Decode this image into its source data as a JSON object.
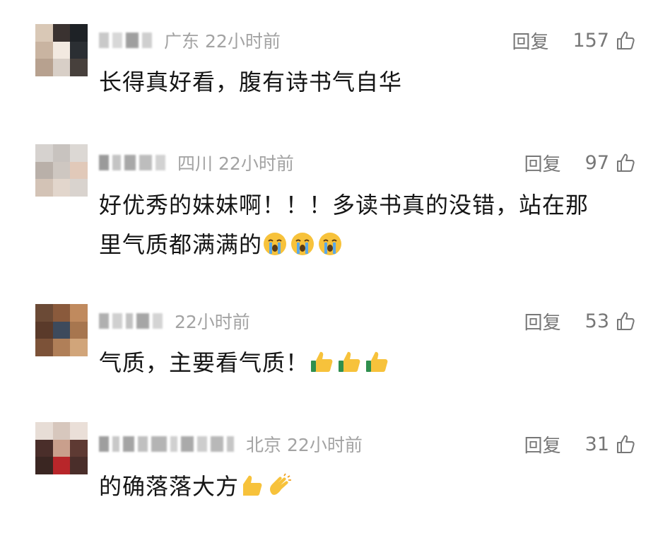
{
  "comments": [
    {
      "location": "广东",
      "time": "22小时前",
      "reply_label": "回复",
      "likes": "157",
      "text": "长得真好看，腹有诗书气自华",
      "emojis": []
    },
    {
      "location": "四川",
      "time": "22小时前",
      "reply_label": "回复",
      "likes": "97",
      "text_line1": "好优秀的妹妹啊！！！多读书真的没错，站在那",
      "text_line2": "里气质都满满的",
      "emojis": [
        "crying-face-emoji",
        "crying-face-emoji",
        "crying-face-emoji"
      ]
    },
    {
      "location": "",
      "time": "22小时前",
      "reply_label": "回复",
      "likes": "53",
      "text": "气质，主要看气质！",
      "emojis": [
        "thumbs-up-emoji",
        "thumbs-up-emoji",
        "thumbs-up-emoji"
      ]
    },
    {
      "location": "北京",
      "time": "22小时前",
      "reply_label": "回复",
      "likes": "31",
      "text": "的确落落大方",
      "emojis": [
        "thumbs-up-emoji",
        "clapping-hands-emoji"
      ]
    }
  ],
  "colors": {
    "meta_gray": "#a3a3a3",
    "action_gray": "#777777",
    "text": "#151515",
    "emoji_yellow": "#f7c23b"
  }
}
